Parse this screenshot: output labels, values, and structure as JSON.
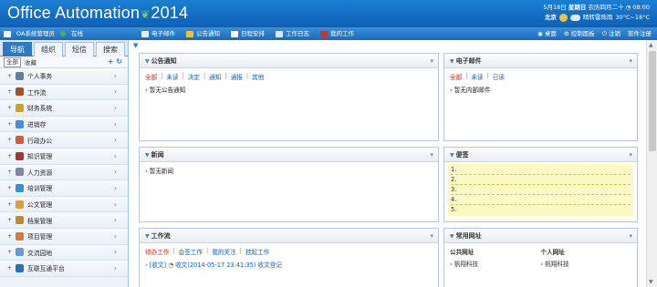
{
  "header": {
    "logo_text": "Office Automation",
    "logo_year": "2014",
    "date": "5月18日",
    "weekday": "星期日",
    "lunar": "农历四月二十",
    "time": "08:00",
    "city": "北京",
    "weather": "晴转雷阵雨",
    "temp": "30°C~18°C"
  },
  "toolbar": {
    "org": "OA系统管理员",
    "status": "在线",
    "menu": [
      "电子邮件",
      "公告通知",
      "日程安排",
      "工作日志",
      "我的工作"
    ],
    "right": [
      "桌面",
      "控制面板",
      "注销",
      "软件注册"
    ]
  },
  "sidebar": {
    "tabs": [
      "导航",
      "组织",
      "短信",
      "搜索"
    ],
    "sub_all": "全部",
    "sub_fav": "收藏",
    "items": [
      {
        "label": "个人事务",
        "color": "#5f7fa5"
      },
      {
        "label": "工作流",
        "color": "#a0522d"
      },
      {
        "label": "财务系统",
        "color": "#c9a227"
      },
      {
        "label": "进销存",
        "color": "#4a8fd6"
      },
      {
        "label": "行政办公",
        "color": "#d65a3a"
      },
      {
        "label": "知识管理",
        "color": "#b03030"
      },
      {
        "label": "人力资源",
        "color": "#7c8a9c"
      },
      {
        "label": "培训管理",
        "color": "#3d8fcb"
      },
      {
        "label": "公文管理",
        "color": "#d2a23b"
      },
      {
        "label": "档案管理",
        "color": "#c48a2a"
      },
      {
        "label": "项目管理",
        "color": "#d67a3a"
      },
      {
        "label": "交流园地",
        "color": "#6a9bd0"
      },
      {
        "label": "互联互通平台",
        "color": "#2f6fb5"
      }
    ]
  },
  "panels": {
    "notice": {
      "title": "公告通知",
      "filters": [
        "全部",
        "未读",
        "决定",
        "通知",
        "通报",
        "其他"
      ],
      "empty": "暂无公告通知"
    },
    "email": {
      "title": "电子邮件",
      "filters": [
        "全部",
        "未读",
        "已读"
      ],
      "empty": "暂无内部邮件"
    },
    "news": {
      "title": "新闻",
      "empty": "暂无新闻"
    },
    "memo": {
      "title": "便签",
      "lines": [
        "1.",
        "2.",
        "3.",
        "4.",
        "5."
      ]
    },
    "workflow": {
      "title": "工作流",
      "filters": [
        "待办工作",
        "会签工作",
        "我的关注",
        "挂起工作"
      ],
      "item_prefix": "[收文]",
      "item_text": "收文(2014-05-17 23:41:35)",
      "item_suffix": "收文登记"
    },
    "links": {
      "title": "常用网址",
      "public_title": "公共网址",
      "public_item": "帆翔科技",
      "personal_title": "个人网址",
      "personal_item": "帆翔科技"
    }
  }
}
